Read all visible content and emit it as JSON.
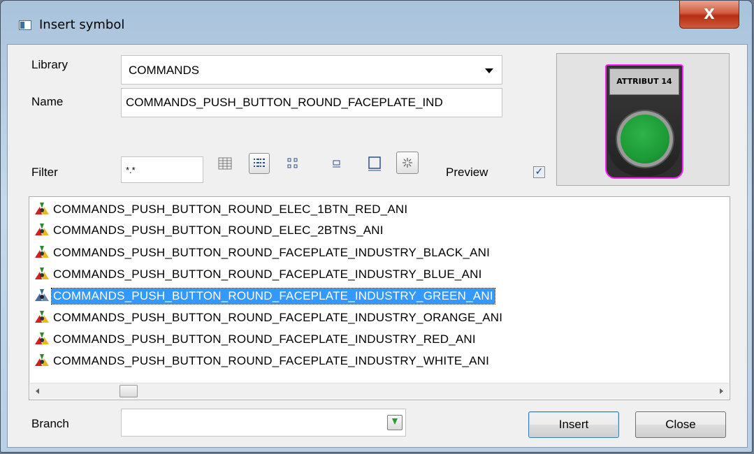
{
  "window": {
    "title": "Insert symbol",
    "close_glyph": "X"
  },
  "form": {
    "library_label": "Library",
    "library_value": "COMMANDS",
    "name_label": "Name",
    "name_value": "COMMANDS_PUSH_BUTTON_ROUND_FACEPLATE_IND",
    "filter_label": "Filter",
    "filter_value": "*.*",
    "preview_label": "Preview",
    "preview_checked": true,
    "branch_label": "Branch",
    "branch_value": ""
  },
  "preview": {
    "symbol_label": "ATTRIBUT 14"
  },
  "toolbar": {
    "icons": [
      "details-view-icon",
      "list-view-icon",
      "small-icons-view-icon",
      "medium-icon-view-icon",
      "large-icon-view-icon",
      "animation-icon"
    ],
    "active": [
      "list-view-icon",
      "animation-icon"
    ]
  },
  "symbols": {
    "items": [
      "COMMANDS_PUSH_BUTTON_ROUND_ELEC_1BTN_RED_ANI",
      "COMMANDS_PUSH_BUTTON_ROUND_ELEC_2BTNS_ANI",
      "COMMANDS_PUSH_BUTTON_ROUND_FACEPLATE_INDUSTRY_BLACK_ANI",
      "COMMANDS_PUSH_BUTTON_ROUND_FACEPLATE_INDUSTRY_BLUE_ANI",
      "COMMANDS_PUSH_BUTTON_ROUND_FACEPLATE_INDUSTRY_GREEN_ANI",
      "COMMANDS_PUSH_BUTTON_ROUND_FACEPLATE_INDUSTRY_ORANGE_ANI",
      "COMMANDS_PUSH_BUTTON_ROUND_FACEPLATE_INDUSTRY_RED_ANI",
      "COMMANDS_PUSH_BUTTON_ROUND_FACEPLATE_INDUSTRY_WHITE_ANI"
    ],
    "selected_index": 4
  },
  "buttons": {
    "insert": "Insert",
    "close": "Close"
  },
  "colors": {
    "selection": "#3399ff",
    "preview_border": "#ff22ff",
    "symbol_green": "#1d9b36"
  }
}
